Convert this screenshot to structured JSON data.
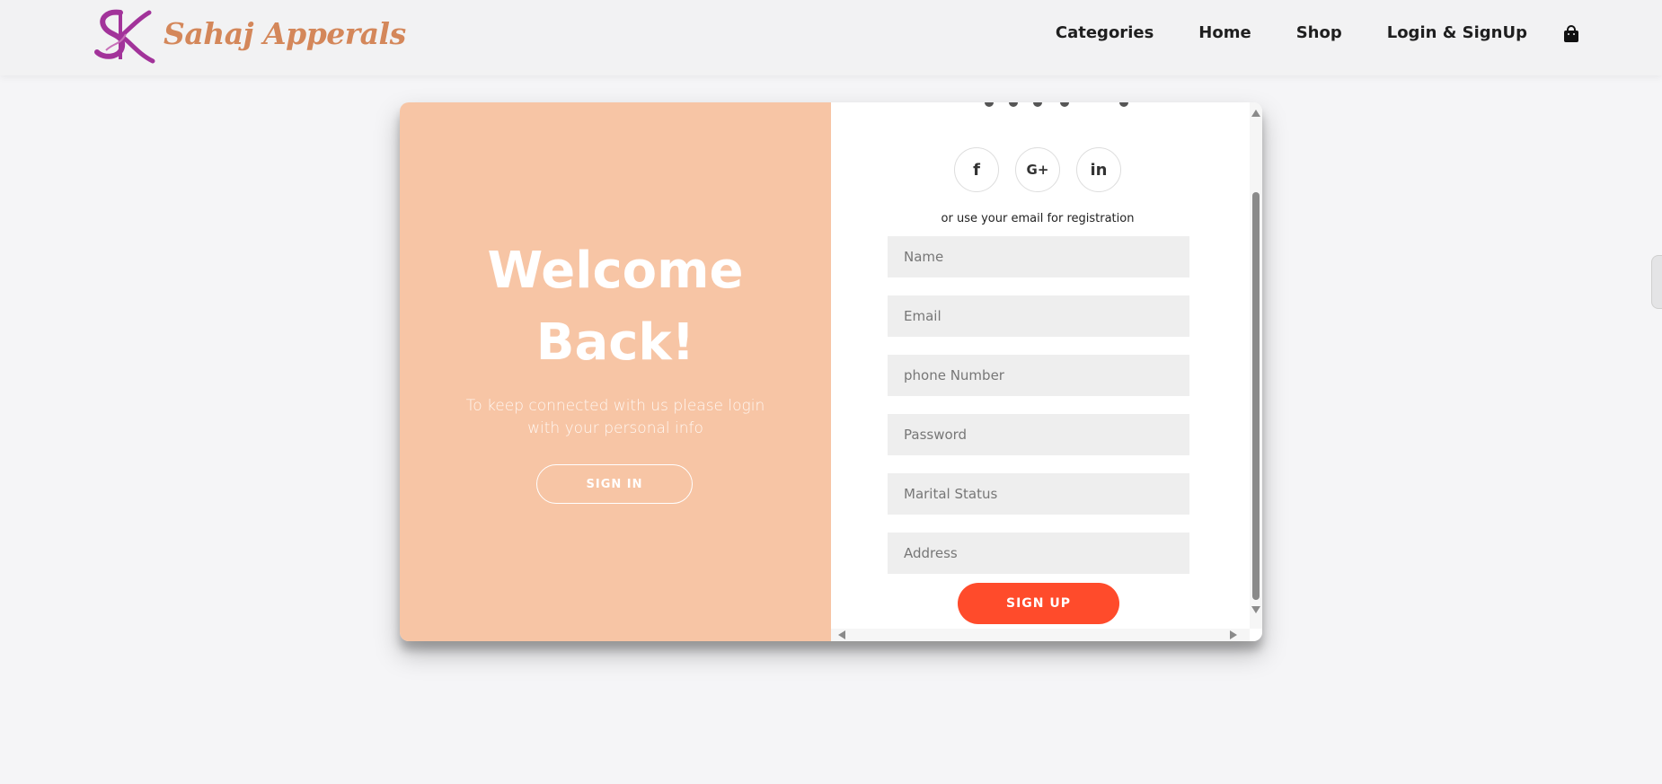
{
  "brand": {
    "name": "Sahaj Apperals",
    "logo_color": "#a2339a",
    "name_color": "#d4875a"
  },
  "nav": {
    "items": [
      "Categories",
      "Home",
      "Shop",
      "Login & SignUp"
    ],
    "cart_icon": "shopping-bag-icon"
  },
  "overlay": {
    "title_line1": "Welcome",
    "title_line2": "Back!",
    "subtitle": "To keep connected with us please login with your personal info",
    "button_label": "SIGN IN",
    "background": "#f7c5a5"
  },
  "signup_form": {
    "socials": [
      {
        "icon": "facebook-icon",
        "glyph": "f"
      },
      {
        "icon": "google-plus-icon",
        "glyph": "G+"
      },
      {
        "icon": "linkedin-icon",
        "glyph": "in"
      }
    ],
    "registration_text": "or use your email for registration",
    "fields": [
      {
        "placeholder": "Name"
      },
      {
        "placeholder": "Email"
      },
      {
        "placeholder": "phone Number"
      },
      {
        "placeholder": "Password"
      },
      {
        "placeholder": "Marital Status"
      },
      {
        "placeholder": "Address"
      }
    ],
    "submit_label": "SIGN UP",
    "submit_color": "#ff4b2b"
  }
}
